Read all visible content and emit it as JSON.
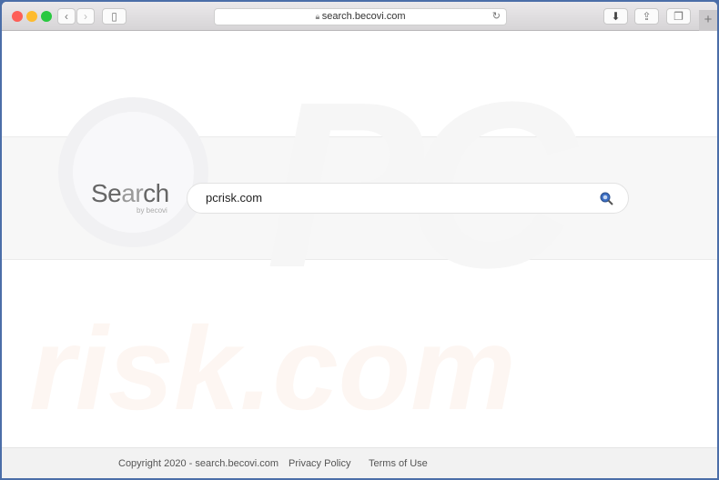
{
  "browser": {
    "url": "search.becovi.com",
    "icons": [
      "back-icon",
      "forward-icon",
      "sidebar-icon",
      "lock-icon",
      "reload-icon",
      "download-icon",
      "share-icon",
      "tabs-icon",
      "new-tab-icon"
    ]
  },
  "logo": {
    "text_a": "Se",
    "text_b": "ar",
    "text_c": "ch",
    "byline": "by becovi"
  },
  "search": {
    "value": "pcrisk.com",
    "icon": "search-icon"
  },
  "watermark": {
    "line1": "PC",
    "line2": "risk.com"
  },
  "footer": {
    "copyright": "Copyright 2020 - search.becovi.com",
    "privacy": "Privacy Policy",
    "terms": "Terms of Use"
  }
}
